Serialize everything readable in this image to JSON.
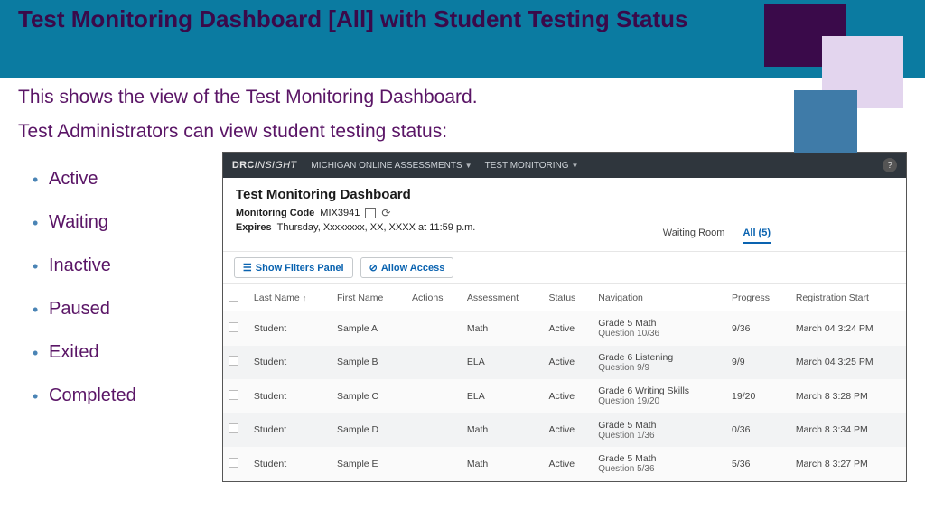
{
  "slide": {
    "title": "Test Monitoring Dashboard [All] with Student Testing Status",
    "intro1": "This shows the view of the Test Monitoring Dashboard.",
    "intro2": "Test Administrators can view student testing status:"
  },
  "statuses": [
    "Active",
    "Waiting",
    "Inactive",
    "Paused",
    "Exited",
    "Completed"
  ],
  "app": {
    "brand_drc": "DRC",
    "brand_insight": "INSIGHT",
    "nav1": "MICHIGAN ONLINE ASSESSMENTS",
    "nav2": "TEST MONITORING",
    "help": "?",
    "title": "Test Monitoring Dashboard",
    "code_label": "Monitoring Code",
    "code_value": "MIX3941",
    "expires_label": "Expires",
    "expires_value": "Thursday,  Xxxxxxxx, XX, XXXX at 11:59 p.m.",
    "tab_waiting": "Waiting Room",
    "tab_all": "All (5)",
    "btn_filters": "Show Filters Panel",
    "btn_allow": "Allow Access",
    "cols": {
      "last": "Last Name",
      "first": "First Name",
      "actions": "Actions",
      "assessment": "Assessment",
      "status": "Status",
      "navigation": "Navigation",
      "progress": "Progress",
      "regstart": "Registration Start"
    },
    "rows": [
      {
        "last": "Student",
        "first": "Sample A",
        "assessment": "Math",
        "status": "Active",
        "nav_a": "Grade 5 Math",
        "nav_b": "Question 10/36",
        "progress": "9/36",
        "reg": "March 04 3:24 PM"
      },
      {
        "last": "Student",
        "first": "Sample B",
        "assessment": "ELA",
        "status": "Active",
        "nav_a": "Grade 6 Listening",
        "nav_b": "Question 9/9",
        "progress": "9/9",
        "reg": "March 04 3:25 PM"
      },
      {
        "last": "Student",
        "first": "Sample C",
        "assessment": "ELA",
        "status": "Active",
        "nav_a": "Grade 6 Writing Skills",
        "nav_b": "Question 19/20",
        "progress": "19/20",
        "reg": "March 8 3:28 PM"
      },
      {
        "last": "Student",
        "first": "Sample D",
        "assessment": "Math",
        "status": "Active",
        "nav_a": "Grade 5 Math",
        "nav_b": "Question 1/36",
        "progress": "0/36",
        "reg": "March 8 3:34 PM"
      },
      {
        "last": "Student",
        "first": "Sample E",
        "assessment": "Math",
        "status": "Active",
        "nav_a": "Grade 5 Math",
        "nav_b": "Question 5/36",
        "progress": "5/36",
        "reg": "March 8 3:27 PM"
      }
    ]
  }
}
